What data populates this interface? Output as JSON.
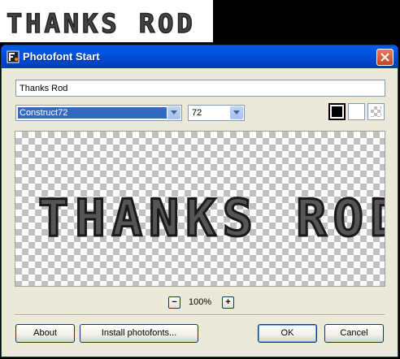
{
  "banner": {
    "text": "THANKS ROD"
  },
  "window": {
    "title": "Photofont Start",
    "icon": "photofont-app-icon",
    "close_icon": "close-icon"
  },
  "text_input": {
    "value": "Thanks Rod"
  },
  "font_select": {
    "selected": "Construct72"
  },
  "size_select": {
    "selected": "72"
  },
  "background_swatches": [
    {
      "name": "black",
      "color": "#000000"
    },
    {
      "name": "white",
      "color": "#ffffff"
    },
    {
      "name": "transparent",
      "color": "checker"
    }
  ],
  "preview": {
    "text": "THANKS ROD"
  },
  "zoom": {
    "minus": "−",
    "value": "100%",
    "plus": "+"
  },
  "buttons": {
    "about": "About",
    "install": "Install photofonts...",
    "ok": "OK",
    "cancel": "Cancel"
  },
  "colors": {
    "titlebar": "#0058e6",
    "close_button": "#d4512b",
    "selection": "#316ac5",
    "dialog_bg": "#ece9d8"
  }
}
